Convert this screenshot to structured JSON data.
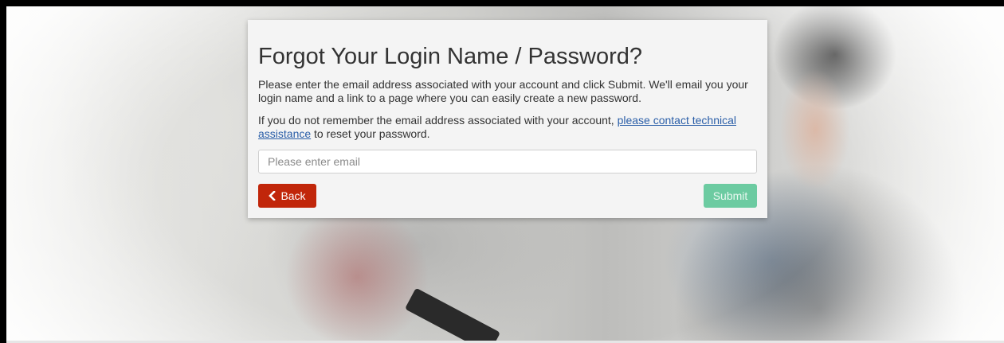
{
  "form": {
    "title": "Forgot Your Login Name / Password?",
    "intro_text": "Please enter the email address associated with your account and click Submit. We'll email you your login name and a link to a page where you can easily create a new password.",
    "help_text_before": "If you do not remember the email address associated with your account, ",
    "help_link_text": "please contact technical assistance",
    "help_text_after": " to reset your password.",
    "email_placeholder": "Please enter email",
    "email_value": "",
    "back_label": "Back",
    "back_icon": "chevron-left-icon",
    "submit_label": "Submit"
  },
  "colors": {
    "back_button": "#c1260a",
    "submit_button_disabled": "#6ccba1",
    "link": "#2a5ea8",
    "panel_bg": "#f4f4f4"
  }
}
